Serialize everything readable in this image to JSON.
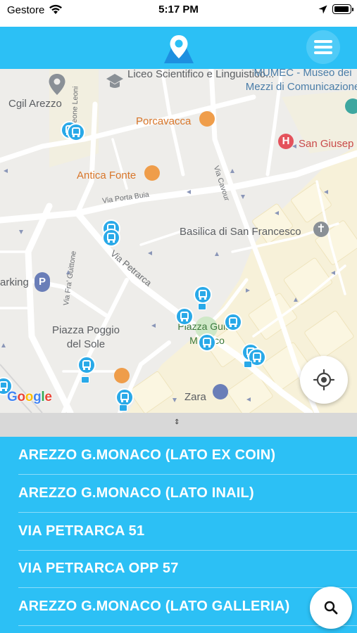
{
  "status_bar": {
    "carrier": "Gestore",
    "time": "5:17 PM",
    "icons": [
      "wifi-icon",
      "location-arrow-icon",
      "battery-icon"
    ]
  },
  "header": {
    "logo_icon": "map-pin-logo-icon",
    "menu_icon": "hamburger-menu-icon",
    "color": "#2cc0f5"
  },
  "map": {
    "labels": {
      "liceo": "Liceo Scientifico\ne Linguistico...",
      "mumec": "MUMEC - Museo dei\nMezzi di Comunicazione",
      "cgil": "Cgil Arezzo",
      "porcavacca": "Porcavacca",
      "san_giuseppe": "San Giusep",
      "antica_fonte": "Antica Fonte",
      "basilica": "Basilica di San Francesco",
      "parking": "arking",
      "piazza_poggio": "Piazza Poggio\ndel Sole",
      "piazza_guido": "Piazza Guido\nMonaco",
      "zara": "Zara",
      "via_leone_leoni": "Via Leone Leoni",
      "via_cavour": "Via Cavour",
      "via_porta_buia": "Via Porta Buia",
      "via_petrarca": "Via Petrarca",
      "via_fra_guittone": "Via Fra' Guittone",
      "google": "Google"
    },
    "icons": [
      "bus-stop-icon",
      "restaurant-icon",
      "hospital-icon",
      "museum-icon",
      "school-icon",
      "church-icon",
      "parking-icon",
      "shopping-icon",
      "my-location-icon"
    ]
  },
  "splitter": {
    "handle": "⇕"
  },
  "stops": [
    "AREZZO G.MONACO (LATO EX COIN)",
    "AREZZO G.MONACO (LATO INAIL)",
    "VIA PETRARCA 51",
    "VIA PETRARCA OPP 57",
    "AREZZO G.MONACO (LATO GALLERIA)"
  ],
  "search_fab": {
    "icon": "search-icon"
  }
}
